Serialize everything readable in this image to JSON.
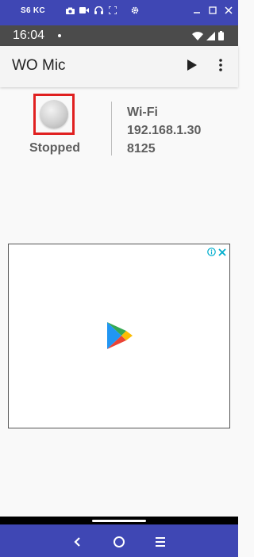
{
  "emulator": {
    "title": "S6 KC",
    "tools": [
      "camera-icon",
      "video-icon",
      "headphones-icon",
      "fullscreen-icon",
      "settings-icon"
    ],
    "window_controls": [
      "minimize-icon",
      "maximize-icon",
      "close-icon"
    ]
  },
  "status_bar": {
    "time": "16:04",
    "icons": [
      "wifi-icon",
      "cellular-signal-icon",
      "battery-icon"
    ]
  },
  "app_bar": {
    "title": "WO Mic",
    "actions": [
      "play-icon",
      "more-vert-icon"
    ]
  },
  "main": {
    "state_label": "Stopped",
    "connection": {
      "transport": "Wi-Fi",
      "ip": "192.168.1.30",
      "port": "8125"
    }
  },
  "ad": {
    "choices_icons": [
      "info-icon",
      "close-icon"
    ],
    "logo": "google-play-icon"
  },
  "nav_bar": {
    "buttons": [
      "back-icon",
      "home-icon",
      "menu-icon"
    ]
  },
  "colors": {
    "emulator_bar": "#3f47b4",
    "status_bar": "#4b4b4b",
    "toggle_highlight": "#e02020",
    "text_secondary": "#5e5e5e",
    "ad_choices": "#00aecd"
  }
}
